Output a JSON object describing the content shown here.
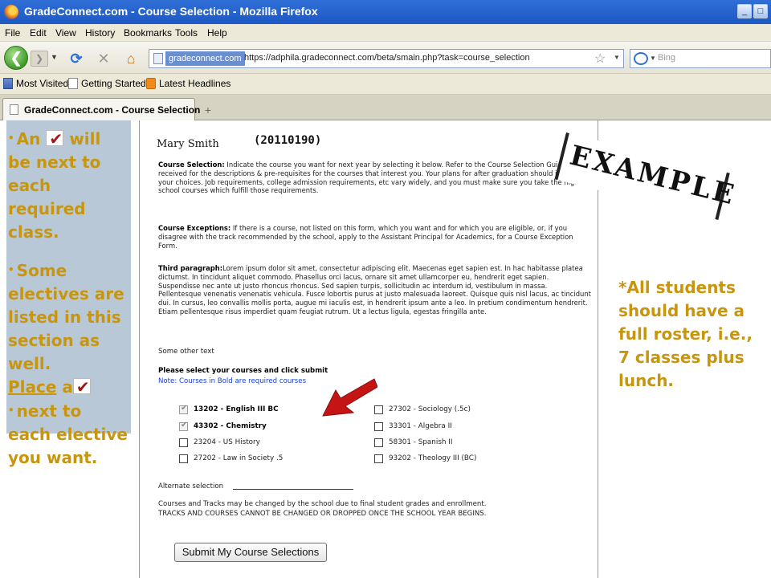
{
  "browser": {
    "window_title": "GradeConnect.com - Course Selection - Mozilla Firefox",
    "menu": [
      "File",
      "Edit",
      "View",
      "History",
      "Bookmarks",
      "Tools",
      "Help"
    ],
    "site_badge": "gradeconnect.com",
    "url": "https://adphila.gradeconnect.com/beta/smain.php?task=course_selection",
    "search_placeholder": "Bing",
    "bookmarks": [
      "Most Visited",
      "Getting Started",
      "Latest Headlines"
    ],
    "tab_title": "GradeConnect.com - Course Selection",
    "new_tab": "+"
  },
  "left_note": {
    "line1_a": "An",
    "line1_b": "will be next to each required class.",
    "line2": "Some electives are listed in this section as well.",
    "line3_a": "Place",
    "line3_b": "a",
    "line4": "next to each elective you want."
  },
  "form": {
    "student_name": "Mary Smith",
    "student_id": "(20110190)",
    "para1_label": "Course Selection:",
    "para1_text": " Indicate the course you want for next year by selecting it below. Refer to the Course Selection Guide you received for the descriptions & pre-requisites for the courses that interest you. Your plans for after graduation should influence your choices. Job requirements, college admission requirements, etc vary widely, and you must make sure you take the high school courses which fulfill those requirements.",
    "para2_label": "Course Exceptions:",
    "para2_text": " If there is a course, not listed on this form, which you want and for which you are eligible, or, if you disagree with the track recommended by the school, apply to the Assistant Principal for Academics, for a Course Exception Form.",
    "para3_label": "Third paragraph:",
    "para3_text": "Lorem ipsum dolor sit amet, consectetur adipiscing elit. Maecenas eget sapien est. In hac habitasse platea dictumst. In tincidunt aliquet commodo. Phasellus orci lacus, ornare sit amet ullamcorper eu, hendrerit eget sapien. Suspendisse nec ante ut justo rhoncus rhoncus. Sed sapien turpis, sollicitudin ac interdum id, vestibulum in massa. Pellentesque venenatis venenatis vehicula. Fusce lobortis purus at justo malesuada laoreet. Quisque quis nisl lacus, ac tincidunt dui. In cursus, leo convallis mollis porta, augue mi iaculis est, in hendrerit ipsum ante a leo. In pretium condimentum hendrerit. Etiam pellentesque risus imperdiet quam feugiat rutrum. Ut a lectus ligula, egestas fringilla ante.",
    "other_text": "Some other text",
    "select_prompt": "Please select your courses and click submit",
    "note": "Note: Courses in Bold are required courses",
    "courses_left": [
      {
        "label": "13202 - English III BC",
        "required": true,
        "checked": true
      },
      {
        "label": "43302 - Chemistry",
        "required": true,
        "checked": true
      },
      {
        "label": "23204 - US History",
        "required": false,
        "checked": false
      },
      {
        "label": "27202 - Law in Society .5",
        "required": false,
        "checked": false
      }
    ],
    "courses_right": [
      {
        "label": "27302 - Sociology (.5c)",
        "required": false,
        "checked": false
      },
      {
        "label": "33301 - Algebra II",
        "required": false,
        "checked": false
      },
      {
        "label": "58301 - Spanish II",
        "required": false,
        "checked": false
      },
      {
        "label": "93202 - Theology III (BC)",
        "required": false,
        "checked": false
      }
    ],
    "alternate_label": "Alternate selection",
    "disclaimer_1": "Courses and Tracks may be changed by the school due to final student grades and enrollment.",
    "disclaimer_2": "TRACKS AND COURSES CANNOT BE CHANGED OR DROPPED ONCE THE SCHOOL YEAR BEGINS.",
    "submit_label": "Submit My Course Selections"
  },
  "stamp": "EXAMPLE",
  "right_note": "*All students should have a full roster, i.e., 7 classes plus lunch.",
  "colors": {
    "annotation_gold": "#c8960e",
    "checkmark_red": "#a01818",
    "arrow_red": "#c41414",
    "note_blue": "#1a3fd0",
    "left_panel": "#b9c8d6"
  }
}
